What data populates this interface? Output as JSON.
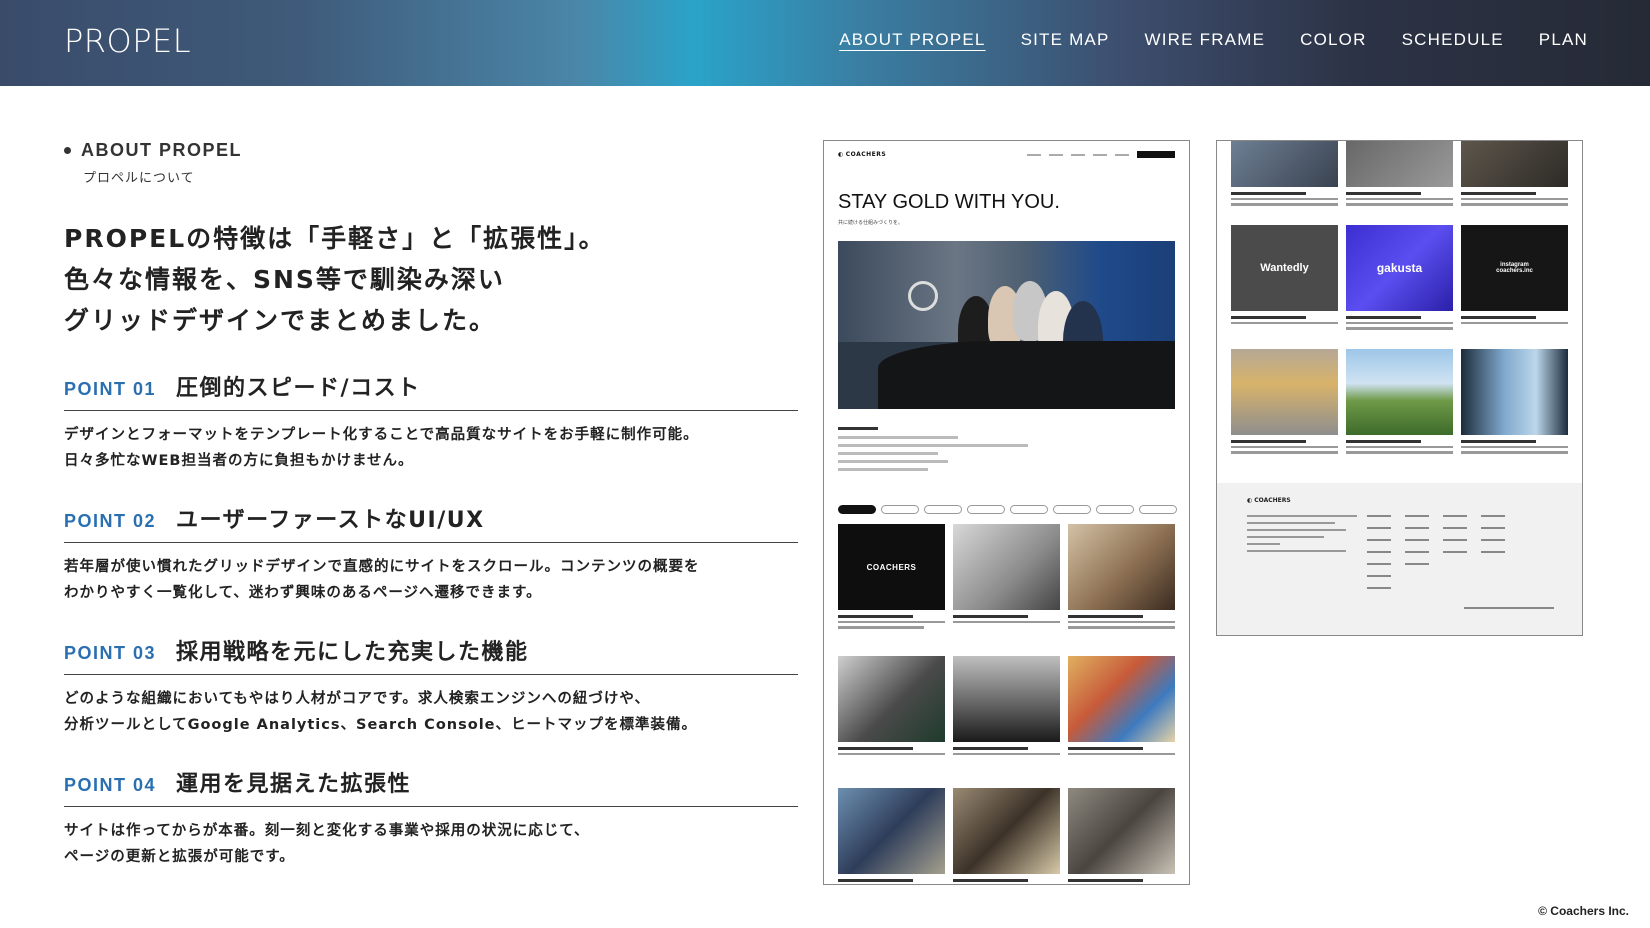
{
  "header": {
    "logo": "PROPEL",
    "nav": [
      {
        "label": "ABOUT PROPEL",
        "active": true
      },
      {
        "label": "SITE MAP"
      },
      {
        "label": "WIRE FRAME"
      },
      {
        "label": "COLOR"
      },
      {
        "label": "SCHEDULE"
      },
      {
        "label": "PLAN"
      }
    ]
  },
  "section": {
    "label_en": "ABOUT PROPEL",
    "label_ja": "プロペルについて",
    "headline": [
      "PROPELの特徴は「手軽さ」と「拡張性」。",
      "色々な情報を、SNS等で馴染み深い",
      "グリッドデザインでまとめました。"
    ]
  },
  "points": [
    {
      "num": "POINT 01",
      "title": "圧倒的スピード/コスト",
      "body": [
        "デザインとフォーマットをテンプレート化することで高品質なサイトをお手軽に制作可能。",
        "日々多忙なWEB担当者の方に負担もかけません。"
      ]
    },
    {
      "num": "POINT 02",
      "title": "ユーザーファーストなUI/UX",
      "body": [
        "若年層が使い慣れたグリッドデザインで直感的にサイトをスクロール。コンテンツの概要を",
        "わかりやすく一覧化して、迷わず興味のあるページへ遷移できます。"
      ]
    },
    {
      "num": "POINT 03",
      "title": "採用戦略を元にした充実した機能",
      "body": [
        "どのような組織においてもやはり人材がコアです。求人検索エンジンへの紐づけや、",
        "分析ツールとしてGoogle Analytics、Search Console、ヒートマップを標準装備。"
      ]
    },
    {
      "num": "POINT 04",
      "title": "運用を見据えた拡張性",
      "body": [
        "サイトは作ってからが本番。刻一刻と変化する事業や採用の状況に応じて、",
        "ページの更新と拡張が可能です。"
      ]
    }
  ],
  "mockup": {
    "brand": "COACHERS",
    "hero_title": "STAY GOLD WITH YOU.",
    "hero_sub": "共に続ける仕組みづくりを。",
    "tiles": {
      "wantedly": "Wantedly",
      "gakusta": "gakusta",
      "instagram": "instagram\ncoachers.inc"
    }
  },
  "copyright": "© Coachers Inc.",
  "colors": {
    "accent": "#2a6fb0",
    "header_gradient_mid": "#2aa3c9",
    "header_dark": "#262a36"
  }
}
